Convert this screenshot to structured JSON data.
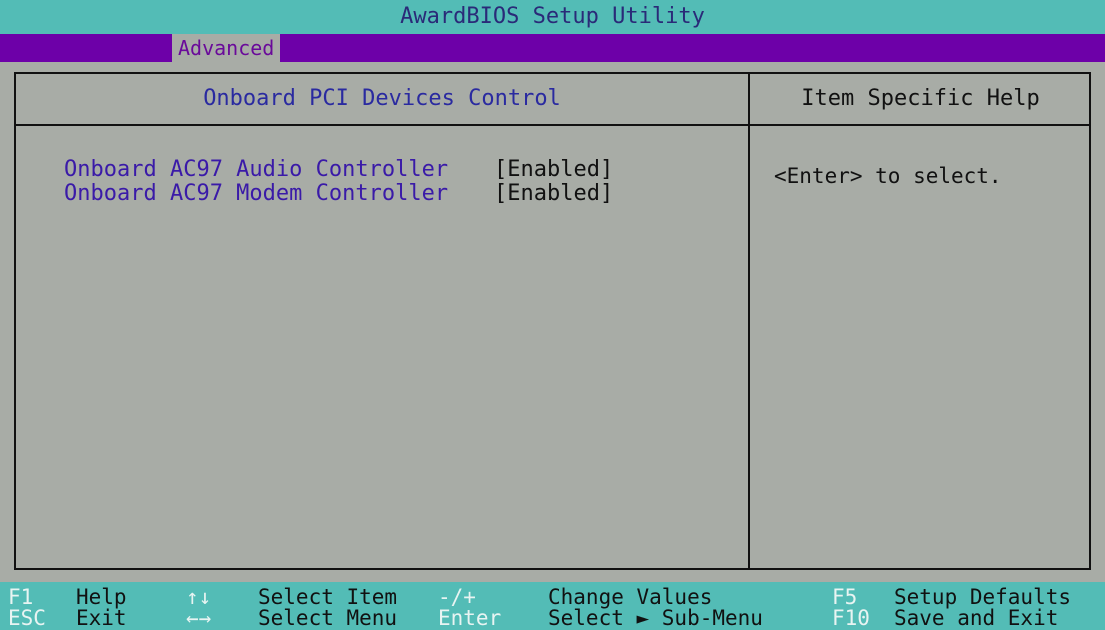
{
  "title": "AwardBIOS Setup Utility",
  "menu": {
    "active_tab": "Advanced"
  },
  "section": {
    "title": "Onboard PCI Devices Control"
  },
  "help": {
    "title": "Item Specific Help",
    "text": "<Enter> to select."
  },
  "settings": [
    {
      "label": "Onboard AC97 Audio Controller",
      "value": "[Enabled]"
    },
    {
      "label": "Onboard AC97 Modem Controller",
      "value": "[Enabled]"
    }
  ],
  "footer": {
    "row1": [
      {
        "key": "F1",
        "desc": "Help"
      },
      {
        "key": "↑↓",
        "desc": "Select Item"
      },
      {
        "key": "-/+",
        "desc": "Change Values"
      },
      {
        "key": "F5",
        "desc": "Setup Defaults"
      }
    ],
    "row2": [
      {
        "key": "ESC",
        "desc": "Exit"
      },
      {
        "key": "←→",
        "desc": "Select Menu"
      },
      {
        "key": "Enter",
        "desc": "Select ► Sub-Menu"
      },
      {
        "key": "F10",
        "desc": "Save and Exit"
      }
    ]
  },
  "colors": {
    "title_bar": "#53bcb6",
    "menu_bar": "#6d00a8",
    "panel": "#a8aca6",
    "label_text": "#3a1aa8"
  }
}
